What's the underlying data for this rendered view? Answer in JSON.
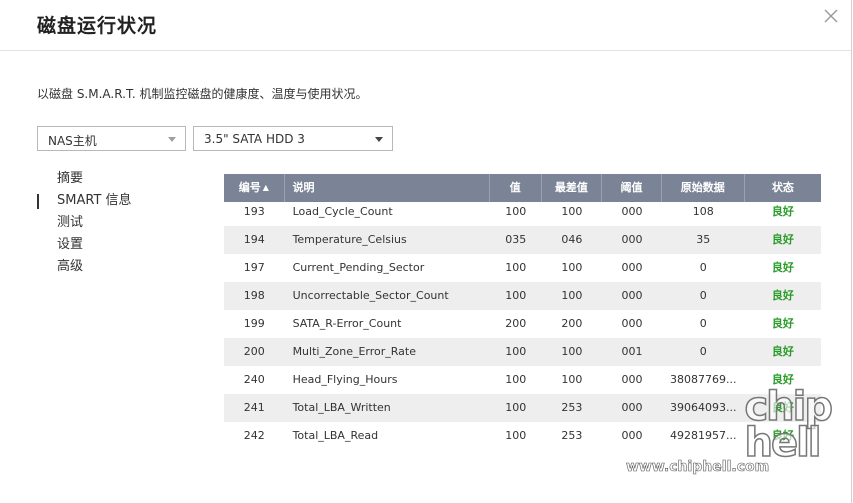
{
  "dialog": {
    "title": "磁盘运行状况",
    "description": "以磁盘 S.M.A.R.T. 机制监控磁盘的健康度、温度与使用状况。"
  },
  "selects": {
    "nas": "NAS主机",
    "disk": "3.5\" SATA HDD 3"
  },
  "nav": [
    {
      "label": "摘要"
    },
    {
      "label": "SMART 信息"
    },
    {
      "label": "测试"
    },
    {
      "label": "设置"
    },
    {
      "label": "高级"
    }
  ],
  "table": {
    "headers": [
      "编号",
      "说明",
      "值",
      "最差值",
      "阈值",
      "原始数据",
      "状态"
    ],
    "sort_indicator": "▲",
    "rows": [
      [
        "193",
        "Load_Cycle_Count",
        "100",
        "100",
        "000",
        "108",
        "良好"
      ],
      [
        "194",
        "Temperature_Celsius",
        "035",
        "046",
        "000",
        "35",
        "良好"
      ],
      [
        "197",
        "Current_Pending_Sector",
        "100",
        "100",
        "000",
        "0",
        "良好"
      ],
      [
        "198",
        "Uncorrectable_Sector_Count",
        "100",
        "100",
        "000",
        "0",
        "良好"
      ],
      [
        "199",
        "SATA_R-Error_Count",
        "200",
        "200",
        "000",
        "0",
        "良好"
      ],
      [
        "200",
        "Multi_Zone_Error_Rate",
        "100",
        "100",
        "001",
        "0",
        "良好"
      ],
      [
        "240",
        "Head_Flying_Hours",
        "100",
        "100",
        "000",
        "38087769...",
        "良好"
      ],
      [
        "241",
        "Total_LBA_Written",
        "100",
        "253",
        "000",
        "39064093...",
        "良好"
      ],
      [
        "242",
        "Total_LBA_Read",
        "100",
        "253",
        "000",
        "49281957...",
        "良好"
      ]
    ]
  },
  "watermark": {
    "logo": "chip hell",
    "url": "www.chiphell.com"
  },
  "colors": {
    "header_bg": "#7b8497",
    "good": "#2a9b2a"
  }
}
